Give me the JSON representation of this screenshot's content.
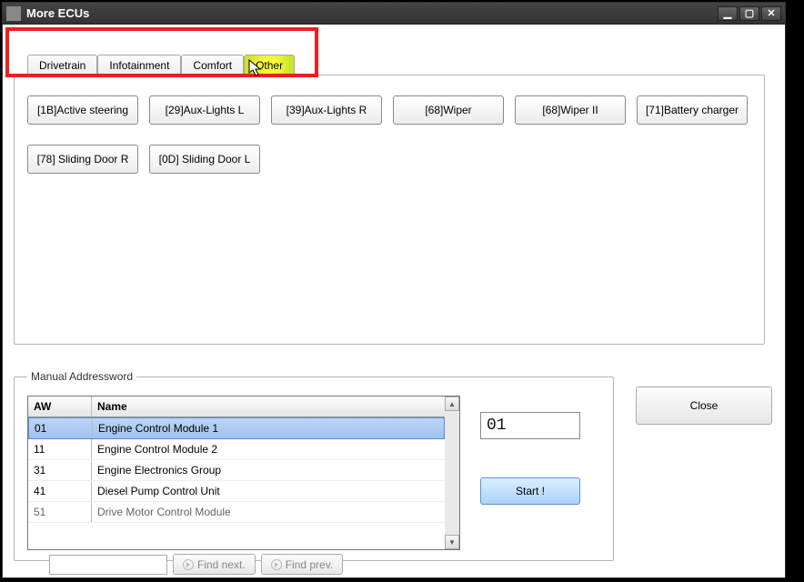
{
  "window": {
    "title": "More ECUs"
  },
  "tabs": [
    {
      "label": "Drivetrain"
    },
    {
      "label": "Infotainment"
    },
    {
      "label": "Comfort"
    },
    {
      "label": "Other"
    }
  ],
  "ecu_buttons_row1": [
    "[1B]Active steering",
    "[29]Aux-Lights  L",
    "[39]Aux-Lights  R",
    "[68]Wiper",
    "[68]Wiper II",
    "[71]Battery charger"
  ],
  "ecu_buttons_row2": [
    "[78] Sliding Door R",
    "[0D] Sliding Door L"
  ],
  "manual": {
    "legend": "Manual Addressword",
    "columns": {
      "aw": "AW",
      "name": "Name"
    },
    "rows": [
      {
        "aw": "01",
        "name": "Engine Control Module 1",
        "selected": true
      },
      {
        "aw": "11",
        "name": "Engine Control Module 2"
      },
      {
        "aw": "31",
        "name": "Engine Electronics Group"
      },
      {
        "aw": "41",
        "name": "Diesel Pump Control Unit"
      },
      {
        "aw": "51",
        "name": "Drive Motor Control Module"
      }
    ],
    "find_next": "Find next.",
    "find_prev": "Find prev.",
    "aw_value": "01",
    "start": "Start !"
  },
  "close": "Close"
}
